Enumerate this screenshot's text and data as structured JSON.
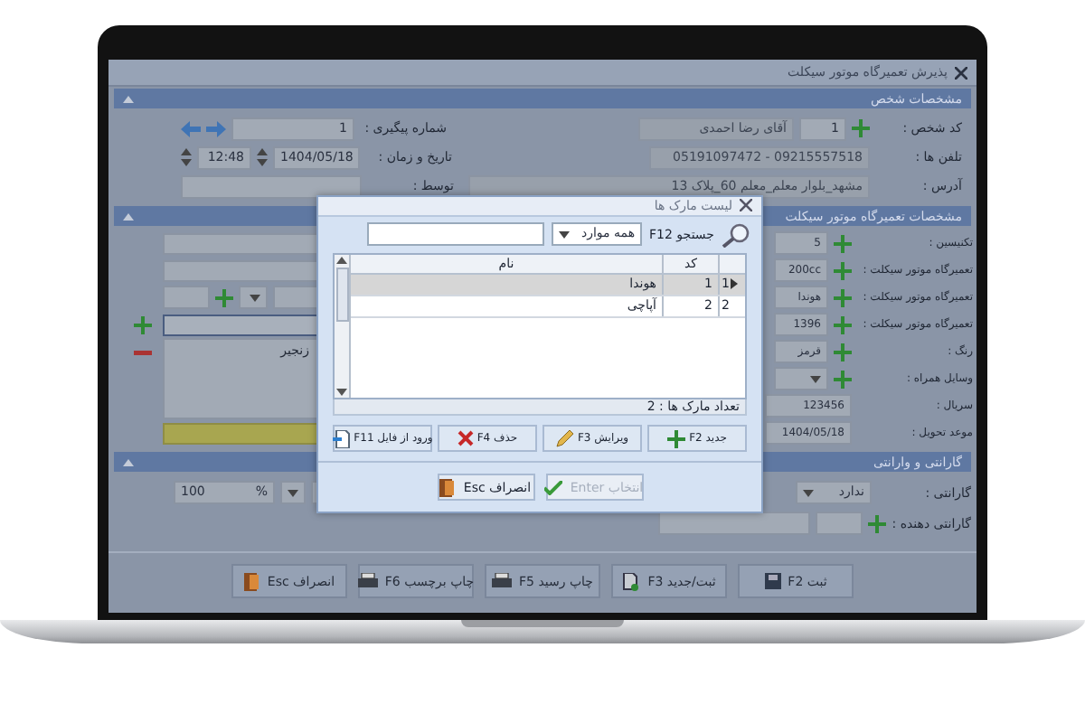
{
  "window": {
    "title": "پذیرش تعمیرگاه موتور سیکلت"
  },
  "person": {
    "title": "مشخصات شخص",
    "code_label": "کد شخص :",
    "code": "1",
    "name": "آقای رضا احمدی",
    "phones_label": "تلفن ها :",
    "phones": "05191097472 - 09215557518",
    "address_label": "آدرس :",
    "address": "مشهد_بلوار معلم_معلم 60_پلاک 13",
    "tracking_label": "شماره پیگیری :",
    "tracking": "1",
    "datetime_label": "تاریخ و زمان :",
    "date": "1404/05/18",
    "time": "12:48",
    "by_label": "توسط :"
  },
  "repair": {
    "title": "مشخصات تعمیرگاه موتور سیکلت",
    "fields": [
      {
        "kind": "plus",
        "label": "تکنیسین :",
        "value": "5"
      },
      {
        "kind": "plus",
        "label": "تعمیرگاه موتور سیکلت :",
        "value": "200cc"
      },
      {
        "kind": "plus",
        "label": "تعمیرگاه موتور سیکلت :",
        "value": "هوندا"
      },
      {
        "kind": "plus",
        "label": "تعمیرگاه موتور سیکلت :",
        "value": "1396"
      },
      {
        "kind": "plus",
        "label": "رنگ :",
        "value": "قرمز"
      },
      {
        "kind": "select-plus",
        "label": "وسایل همراه :"
      },
      {
        "kind": "text",
        "label": "سریال :",
        "value": "123456"
      },
      {
        "kind": "text",
        "label": "موعد تحویل :",
        "value": "1404/05/18"
      }
    ],
    "accessories": [
      "زنجیر"
    ]
  },
  "warranty": {
    "title": "گارانتی و وارانتی",
    "fields": [
      {
        "kind": "select",
        "label": "گارانتی :",
        "value": "ندارد"
      },
      {
        "kind": "plus-pair",
        "label": "گارانتی دهنده :"
      }
    ],
    "percent": "100",
    "percent_sign": "%"
  },
  "buttons": [
    {
      "label": "ثبت F2"
    },
    {
      "label": "ثبت/جدید F3"
    },
    {
      "label": "چاپ رسید F5"
    },
    {
      "label": "چاپ برچسب F6"
    },
    {
      "label": "انصراف Esc"
    }
  ],
  "dialog": {
    "title": "لیست مارک ها",
    "search_label": "جستجو F12",
    "filter": "همه موارد",
    "columns": [
      "کد",
      "نام"
    ],
    "rows": [
      {
        "number": "1",
        "code": "1",
        "name": "هوندا",
        "selected": true
      },
      {
        "number": "2",
        "code": "2",
        "name": "آپاچی",
        "selected": false
      }
    ],
    "count": "تعداد مارک ها : 2",
    "buttons": [
      {
        "label": "جدید F2"
      },
      {
        "label": "ویرایش F3"
      },
      {
        "label": "حذف F4"
      },
      {
        "label": "ورود از فایل F11"
      }
    ],
    "footer_buttons": [
      {
        "label": "انتخاب Enter",
        "disabled": true
      },
      {
        "label": "انصراف Esc",
        "disabled": false
      }
    ]
  }
}
